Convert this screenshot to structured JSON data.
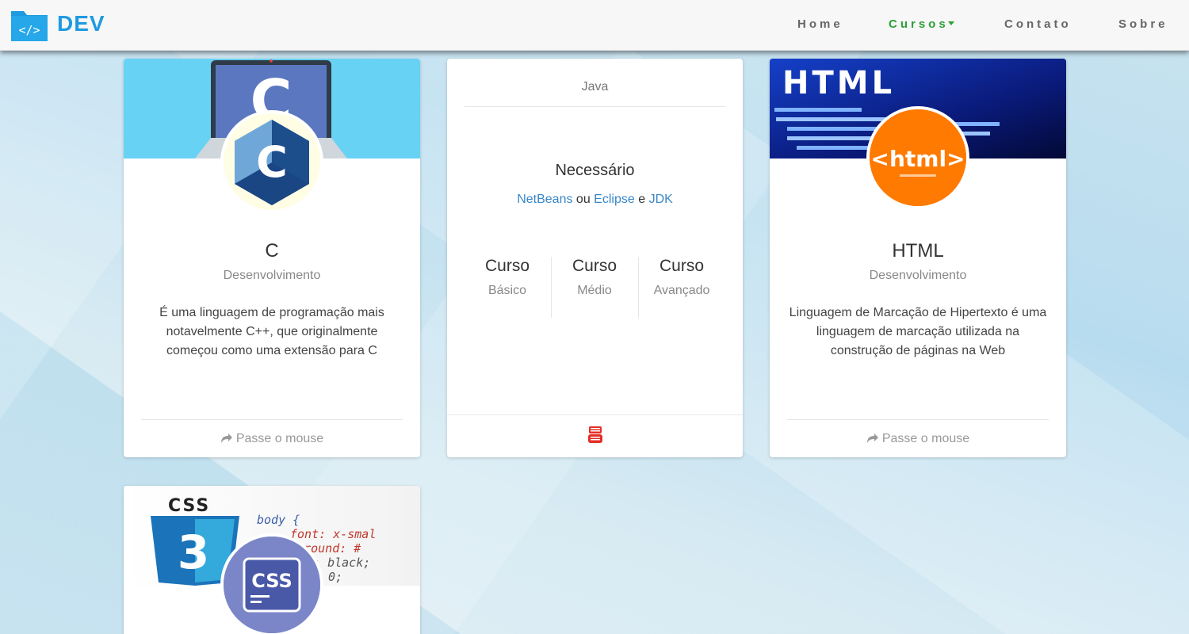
{
  "brand": {
    "name": "DEV",
    "logo_icon": "code-folder-icon",
    "logo_glyph": "</>"
  },
  "nav": {
    "items": [
      {
        "label": "Home"
      },
      {
        "label": "Cursos"
      },
      {
        "label": "Contato"
      },
      {
        "label": "Sobre"
      }
    ],
    "active": "Cursos",
    "active_color": "#2aa034"
  },
  "cards": {
    "c": {
      "title": "C",
      "subtitle": "Desenvolvimento",
      "description": "É uma linguagem de programação mais notavelmente C++, que originalmente começou como uma extensão para C",
      "footer": "Passe o mouse",
      "avatar_letter": "C"
    },
    "java": {
      "header": "Java",
      "requirements_title": "Necessário",
      "links": {
        "netbeans": "NetBeans",
        "or": "ou",
        "eclipse": "Eclipse",
        "and": "e",
        "jdk": "JDK"
      },
      "levels": [
        {
          "title": "Curso",
          "subtitle": "Básico"
        },
        {
          "title": "Curso",
          "subtitle": "Médio"
        },
        {
          "title": "Curso",
          "subtitle": "Avançado"
        }
      ],
      "footer_icon": "youtube-icon"
    },
    "html": {
      "title": "HTML",
      "subtitle": "Desenvolvimento",
      "description": "Linguagem de Marcação de Hipertexto é uma linguagem de marcação utilizada na construção de páginas na Web",
      "footer": "Passe o mouse",
      "banner_text": "HTML",
      "avatar_text": "<html>"
    },
    "css": {
      "banner_logo": "CSS",
      "banner_number": "3",
      "avatar_text": "CSS"
    }
  }
}
